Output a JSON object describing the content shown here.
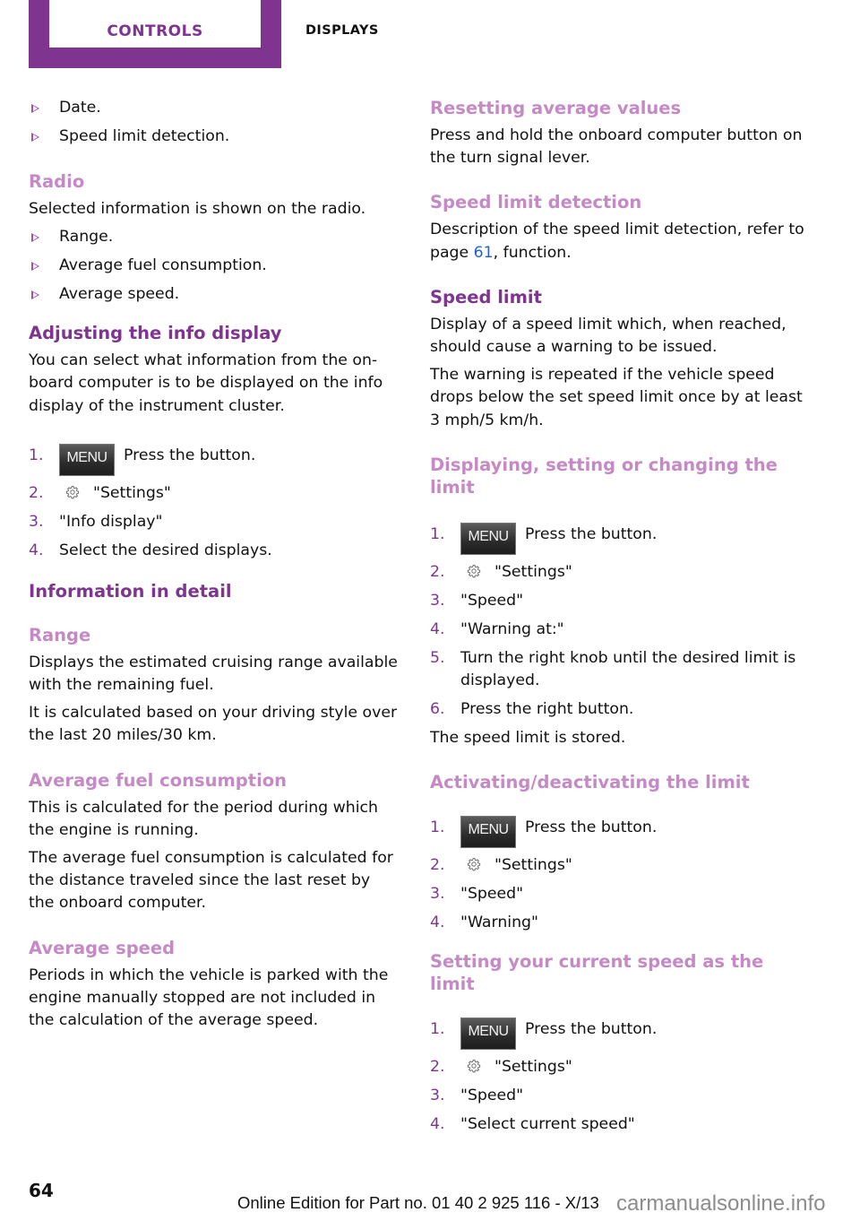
{
  "header": {
    "tab_active": "CONTROLS",
    "tab_section": "DISPLAYS",
    "accent_color": "#7f3590",
    "subheading_color": "#c58ac6"
  },
  "left": {
    "intro_bullets": [
      "Date.",
      "Speed limit detection."
    ],
    "radio": {
      "heading": "Radio",
      "text": "Selected information is shown on the radio.",
      "bullets": [
        "Range.",
        "Average fuel consumption.",
        "Average speed."
      ]
    },
    "adjusting": {
      "heading": "Adjusting the info display",
      "text": "You can select what information from the on-board computer is to be displayed on the info display of the instrument cluster.",
      "steps": [
        {
          "num": "1.",
          "icon": "menu-button",
          "icon_label": "MENU",
          "text": "Press the button."
        },
        {
          "num": "2.",
          "icon": "gear-icon",
          "text": "\"Settings\""
        },
        {
          "num": "3.",
          "text": "\"Info display\""
        },
        {
          "num": "4.",
          "text": "Select the desired displays."
        }
      ]
    },
    "info_detail": {
      "heading": "Information in detail"
    },
    "range": {
      "heading": "Range",
      "paragraphs": [
        "Displays the estimated cruising range available with the remaining fuel.",
        "It is calculated based on your driving style over the last 20 miles/30 km."
      ]
    },
    "avg_fuel": {
      "heading": "Average fuel consumption",
      "paragraphs": [
        "This is calculated for the period during which the engine is running.",
        "The average fuel consumption is calculated for the distance traveled since the last reset by the onboard computer."
      ]
    },
    "avg_speed": {
      "heading": "Average speed",
      "paragraphs": [
        "Periods in which the vehicle is parked with the engine manually stopped are not included in the calculation of the average speed."
      ]
    }
  },
  "right": {
    "resetting": {
      "heading": "Resetting average values",
      "text": "Press and hold the onboard computer button on the turn signal lever."
    },
    "detection": {
      "heading": "Speed limit detection",
      "text_before": "Description of the speed limit detection, refer to page ",
      "page_link": "61",
      "text_after": ", function."
    },
    "speed_limit": {
      "heading": "Speed limit",
      "paragraphs": [
        "Display of a speed limit which, when reached, should cause a warning to be issued.",
        "The warning is repeated if the vehicle speed drops below the set speed limit once by at least 3 mph/5 km/h."
      ]
    },
    "displaying": {
      "heading": "Displaying, setting or changing the limit",
      "steps": [
        {
          "num": "1.",
          "icon": "menu-button",
          "icon_label": "MENU",
          "text": "Press the button."
        },
        {
          "num": "2.",
          "icon": "gear-icon",
          "text": "\"Settings\""
        },
        {
          "num": "3.",
          "text": "\"Speed\""
        },
        {
          "num": "4.",
          "text": "\"Warning at:\""
        },
        {
          "num": "5.",
          "text": "Turn the right knob until the desired limit is displayed."
        },
        {
          "num": "6.",
          "text": "Press the right button."
        }
      ],
      "after": "The speed limit is stored."
    },
    "activating": {
      "heading": "Activating/deactivating the limit",
      "steps": [
        {
          "num": "1.",
          "icon": "menu-button",
          "icon_label": "MENU",
          "text": "Press the button."
        },
        {
          "num": "2.",
          "icon": "gear-icon",
          "text": "\"Settings\""
        },
        {
          "num": "3.",
          "text": "\"Speed\""
        },
        {
          "num": "4.",
          "text": "\"Warning\""
        }
      ]
    },
    "current": {
      "heading": "Setting your current speed as the limit",
      "steps": [
        {
          "num": "1.",
          "icon": "menu-button",
          "icon_label": "MENU",
          "text": "Press the button."
        },
        {
          "num": "2.",
          "icon": "gear-icon",
          "text": "\"Settings\""
        },
        {
          "num": "3.",
          "text": "\"Speed\""
        },
        {
          "num": "4.",
          "text": "\"Select current speed\""
        }
      ]
    }
  },
  "footer": {
    "page_number": "64",
    "edition": "Online Edition for Part no. 01 40 2 925 116 - X/13",
    "watermark": "carmanualsonline.info"
  }
}
